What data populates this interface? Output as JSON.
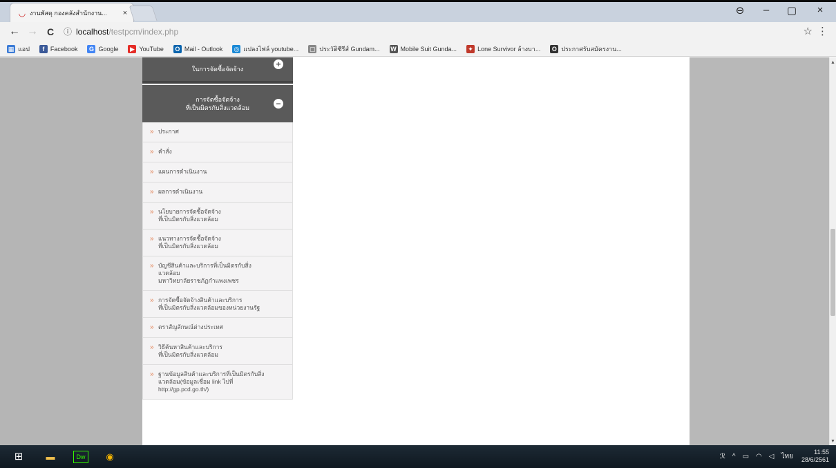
{
  "browser": {
    "tab": {
      "title": "งานพัสดุ กองคลังสำนักงาน...",
      "close": "×",
      "favicon": "pdf-logo-icon"
    },
    "window_controls": {
      "account": "⊖",
      "minimize": "–",
      "maximize": "▢",
      "close": "×"
    },
    "nav": {
      "back": "←",
      "forward": "→",
      "reload": "C"
    },
    "address": {
      "info_icon": "ⓘ",
      "host": "localhost",
      "path": "/testpcm/index.php"
    },
    "star": "☆",
    "menu": "⋮"
  },
  "bookmarks": [
    {
      "label": "แอป",
      "icon": "apps-grid-icon",
      "color": "#3b7bd6"
    },
    {
      "label": "Facebook",
      "icon": "facebook-icon",
      "color": "#3b5998"
    },
    {
      "label": "Google",
      "icon": "google-icon",
      "color": "#4285f4"
    },
    {
      "label": "YouTube",
      "icon": "youtube-icon",
      "color": "#e52d27"
    },
    {
      "label": "Mail - Outlook",
      "icon": "outlook-icon",
      "color": "#0a64ad"
    },
    {
      "label": "แปลงไฟล์ youtube...",
      "icon": "converter-icon",
      "color": "#1c8ad6"
    },
    {
      "label": "ประวัติซีรีส์ Gundam...",
      "icon": "page-icon",
      "color": "#888888"
    },
    {
      "label": "Mobile Suit Gunda...",
      "icon": "wordpress-icon",
      "color": "#555555"
    },
    {
      "label": "Lone Survivor ล้างบา...",
      "icon": "lone-survivor-icon",
      "color": "#c0392b"
    },
    {
      "label": "ประกาศรับสมัครงาน...",
      "icon": "opera-icon",
      "color": "#333333"
    }
  ],
  "sidebar": {
    "top_header": "ในการจัดซื้อจัดจ้าง",
    "top_toggle": "+",
    "main_header": "การจัดซื้อจัดจ้าง\nที่เป็นมิตรกับสิ่งแวดล้อม",
    "main_toggle": "−",
    "bullet": "»",
    "items": [
      "ประกาศ",
      "คำสั่ง",
      "แผนการดำเนินงาน",
      "ผลการดำเนินงาน",
      "นโยบายการจัดซื้อจัดจ้าง\nที่เป็นมิตรกับสิ่งแวดล้อม",
      "แนวทางการจัดซื้อจัดจ้าง\nที่เป็นมิตรกับสิ่งแวดล้อม",
      "บัญชีสินค้าและบริการที่เป็นมิตรกับสิ่ง\nแวดล้อม\nมหาวิทยาลัยราชภัฏกำแพงเพชร",
      "การจัดซื้อจัดจ้างสินค้าและบริการ\nที่เป็นมิตรกับสิ่งแวดล้อมของหน่วยงานรัฐ",
      "ตราสัญลักษณ์ต่างประเทศ",
      "วิธีค้นหาสินค้าและบริการ\nที่เป็นมิตรกับสิ่งแวดล้อม",
      "ฐานข้อมูลสินค้าและบริการที่เป็นมิตรกับสิ่ง\nแวดล้อม(ข้อมูลเชื่อม link ไปที่\nhttp://gp.pcd.go.th/)"
    ]
  },
  "scrollbar": {
    "up": "▲",
    "down": "▼"
  },
  "taskbar": {
    "start": "⊞",
    "apps": [
      {
        "name": "file-explorer-icon",
        "glyph": "▬",
        "color": "#f2c14e"
      },
      {
        "name": "dreamweaver-icon",
        "glyph": "Dw",
        "color": "#35fa00"
      },
      {
        "name": "chrome-icon",
        "glyph": "◉",
        "color": "#f4b400"
      }
    ],
    "tray": {
      "people": "ℛ",
      "chevron": "^",
      "lang": "ไทย",
      "time": "11:55",
      "date": "28/6/2561"
    }
  }
}
